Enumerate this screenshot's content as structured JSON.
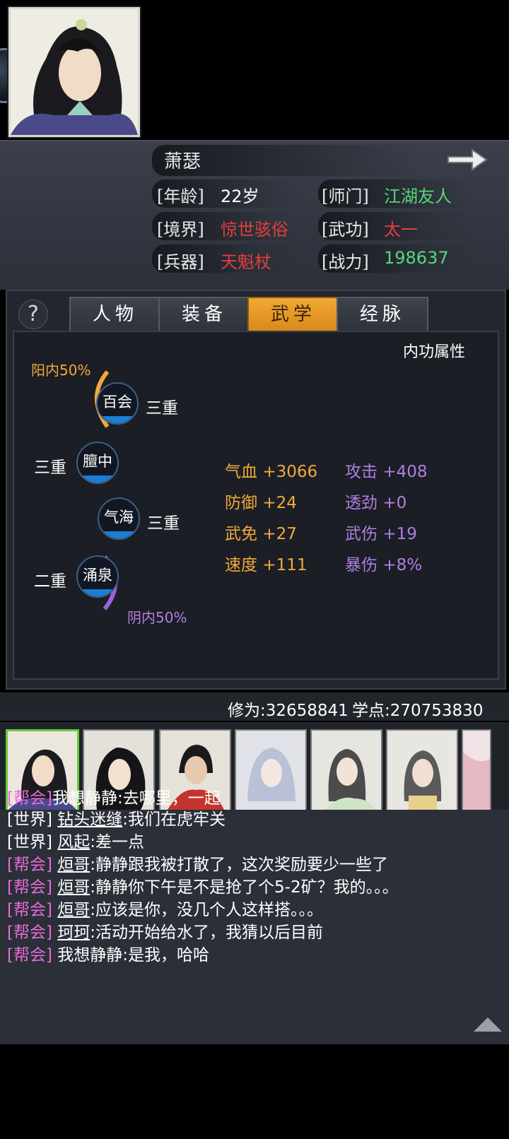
{
  "profile": {
    "name": "萧瑟",
    "age_label": "[年龄]",
    "age": "22岁",
    "sect_label": "[师门]",
    "sect": "江湖友人",
    "realm_label": "[境界]",
    "realm": "惊世骇俗",
    "martial_label": "[武功]",
    "martial": "太一",
    "weapon_label": "[兵器]",
    "weapon": "天魁杖",
    "power_label": "[战力]",
    "power": "198637"
  },
  "tabs": [
    "人物",
    "装备",
    "武学",
    "经脉"
  ],
  "active_tab": "武学",
  "meridian": {
    "section_title": "内功属性",
    "yang": "阳内50%",
    "yin": "阴内50%",
    "nodes": [
      {
        "name": "百会",
        "level": "三重"
      },
      {
        "name": "膻中",
        "level": "三重"
      },
      {
        "name": "气海",
        "level": "三重"
      },
      {
        "name": "涌泉",
        "level": "二重"
      }
    ],
    "stats_left": [
      {
        "label": "气血",
        "value": "+3066"
      },
      {
        "label": "防御",
        "value": "+24"
      },
      {
        "label": "武免",
        "value": "+27"
      },
      {
        "label": "速度",
        "value": "+111"
      }
    ],
    "stats_right": [
      {
        "label": "攻击",
        "value": "+408"
      },
      {
        "label": "透劲",
        "value": "+0"
      },
      {
        "label": "武伤",
        "value": "+19"
      },
      {
        "label": "暴伤",
        "value": "+8%"
      }
    ]
  },
  "cultivation": "修为:32658841",
  "study_points": "学点:270753830",
  "chat": [
    {
      "channel": "[帮会]",
      "user": "",
      "text": "我想静静:去哪里，一起"
    },
    {
      "channel": "[世界]",
      "user": "钻头迷缝",
      "text": ":我们在虎牢关"
    },
    {
      "channel": "[世界]",
      "user": "风起",
      "text": ":差一点"
    },
    {
      "channel": "[帮会]",
      "user": "烜哥",
      "text": ":静静跟我被打散了，这次奖励要少一些了"
    },
    {
      "channel": "[帮会]",
      "user": "烜哥",
      "text": ":静静你下午是不是抢了个5-2矿？我的。。。"
    },
    {
      "channel": "[帮会]",
      "user": "烜哥",
      "text": ":应该是你，没几个人这样搭。。。"
    },
    {
      "channel": "[帮会]",
      "user": "珂珂",
      "text": ":活动开始给水了，我猜以后目前"
    },
    {
      "channel": "[帮会]",
      "user": "",
      "text": "我想静静:是我，哈哈"
    }
  ],
  "colors": {
    "accent_tab": "#f2a935",
    "yang": "#f1a93a",
    "yin": "#b07ee0",
    "guild": "#e86ad8",
    "green": "#58d67a",
    "red": "#e53d3d"
  }
}
